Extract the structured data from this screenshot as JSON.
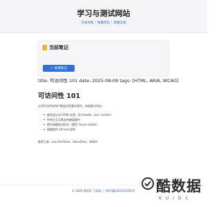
{
  "header": {
    "site_title": "学习与测试网站",
    "nav": [
      "可访问性",
      "性能优化",
      "前端工程"
    ]
  },
  "card": {
    "title": "当前笔记",
    "icon": "notebook-icon",
    "button_label": "新增笔记",
    "button_icon": "plus-icon"
  },
  "article": {
    "meta": "title: 可访问性 101 date: 2025-08-09 tags: [HTML, ARIA, WCAG]",
    "title": "可访问性 101",
    "intro": "让网页对所有用户都友好是基本责任。实践要点包括：",
    "bullets": [
      "使用语义化 HTML 标签（如 header, nav, section）",
      "所有交互元素支持键盘操作",
      "提供清晰焦点样式（使用 :focus-visible）",
      "图像提供 alt text 说明"
    ],
    "tools": "推荐工具：axe DevTools、VoiceOver、NVDA"
  },
  "footer": {
    "copyright": "© 2026 我的学",
    "link": "习网站",
    "extra": "京ICP备2025123456号"
  },
  "watermark": {
    "text": "酷数据",
    "sub": "KUIDC"
  },
  "colors": {
    "accent": "#2f6fda",
    "link": "#2a63c8",
    "header_bg": "#f5f5f7"
  }
}
